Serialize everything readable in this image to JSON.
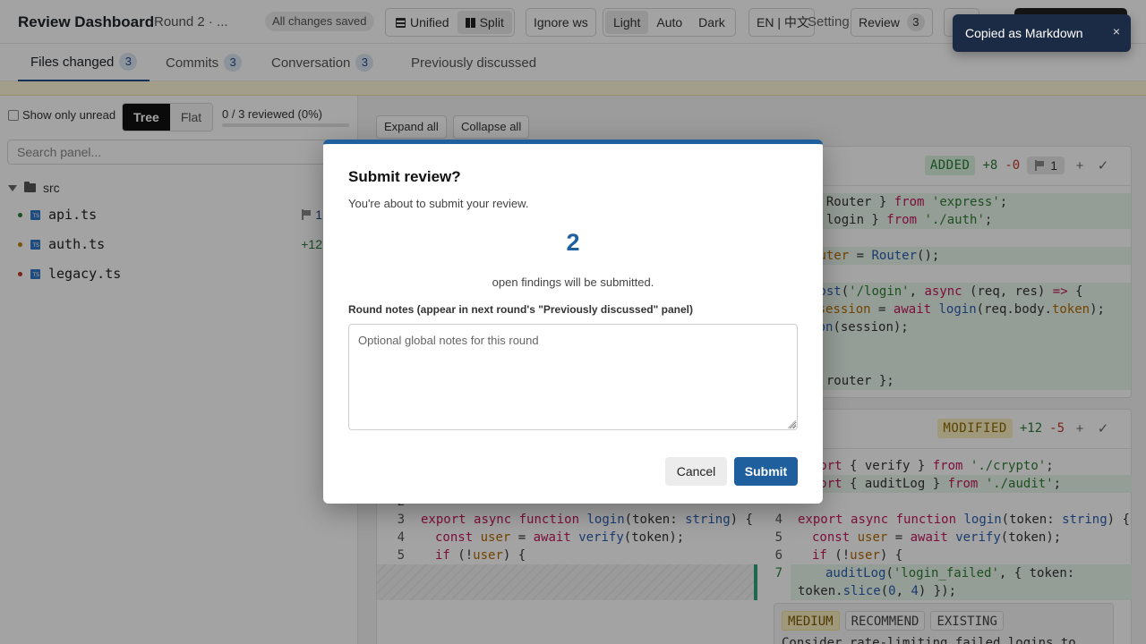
{
  "header": {
    "title": "Review Dashboard",
    "round": "Round 2 · ...",
    "saved_status": "All changes saved",
    "view_modes": [
      "Unified",
      "Split"
    ],
    "active_view": "Split",
    "ignore_ws": "Ignore ws",
    "themes": [
      "Light",
      "Auto",
      "Dark"
    ],
    "active_theme": "Light",
    "language": "EN | 中文",
    "settings": "Setting",
    "review_label": "Review",
    "review_count": "3"
  },
  "tabs": [
    {
      "label": "Files changed",
      "count": "3"
    },
    {
      "label": "Commits",
      "count": "3"
    },
    {
      "label": "Conversation",
      "count": "3"
    },
    {
      "label": "Previously discussed",
      "count": ""
    }
  ],
  "sidebar": {
    "unread_label": "Show only unread",
    "tree_label": "Tree",
    "flat_label": "Flat",
    "reviewed": "0 / 3 reviewed (0%)",
    "reviewed_fraction": 0,
    "search_placeholder": "Search panel...",
    "folder": "src",
    "files": [
      {
        "name": "api.ts",
        "dot_color": "#2a7a39",
        "meta": "1",
        "meta_type": "flag"
      },
      {
        "name": "auth.ts",
        "dot_color": "#b8860b",
        "meta": "+12",
        "meta_type": "plus"
      },
      {
        "name": "legacy.ts",
        "dot_color": "#c0392b",
        "meta": "",
        "meta_type": "none"
      }
    ]
  },
  "main": {
    "expand_all": "Expand all",
    "collapse_all": "Collapse all",
    "card1": {
      "status": "ADDED",
      "plus": "+8",
      "minus": "-0",
      "comments": "1"
    },
    "card2": {
      "status": "MODIFIED",
      "plus": "+12",
      "minus": "-5"
    },
    "finding": {
      "severity": "MEDIUM",
      "kind": "RECOMMEND",
      "state": "EXISTING",
      "text": "Consider rate-limiting failed logins to"
    }
  },
  "modal": {
    "title": "Submit review?",
    "subtitle": "You're about to submit your review.",
    "count": "2",
    "count_label": "open findings will be submitted.",
    "notes_label": "Round notes (appear in next round's \"Previously discussed\" panel)",
    "notes_placeholder": "Optional global notes for this round",
    "cancel": "Cancel",
    "submit": "Submit"
  },
  "toast": {
    "message": "Copied as Markdown",
    "close": "×"
  },
  "colors": {
    "accent": "#1f5f9e",
    "added": "#2a7a39",
    "removed": "#c0392b"
  }
}
